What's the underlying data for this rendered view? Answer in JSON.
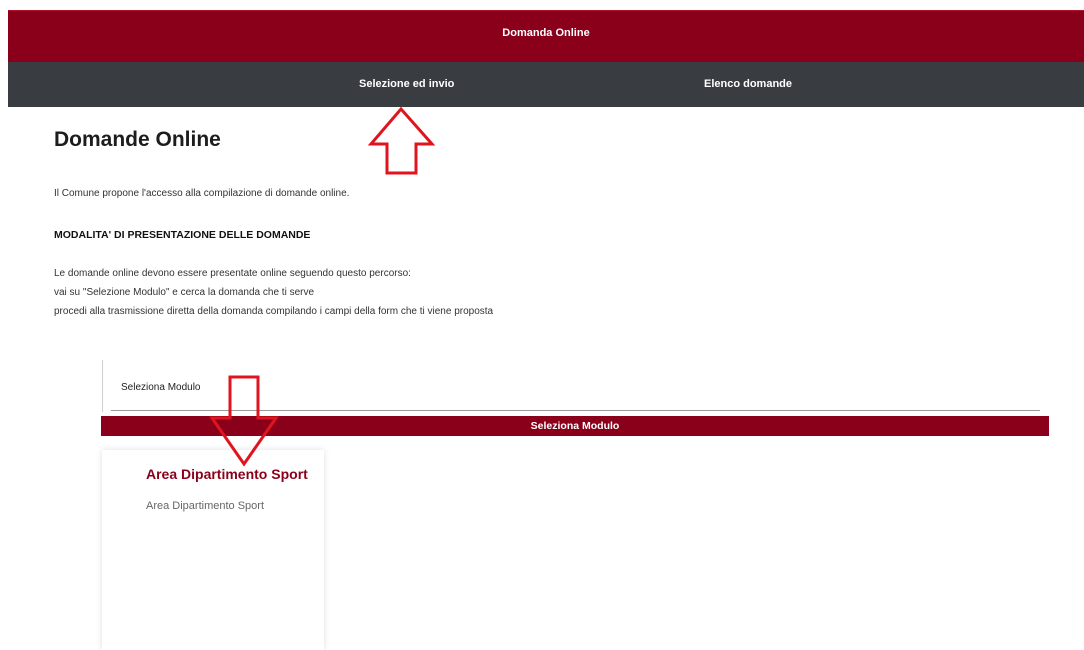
{
  "header": {
    "title": "Domanda Online"
  },
  "subnav": {
    "items": [
      {
        "label": "Selezione ed invio"
      },
      {
        "label": "Elenco domande"
      }
    ]
  },
  "main": {
    "title": "Domande Online",
    "intro": "Il Comune propone l'accesso alla compilazione di domande online.",
    "section_heading": "MODALITA' DI PRESENTAZIONE DELLE DOMANDE",
    "lines": [
      "Le domande online devono essere presentate online seguendo questo percorso:",
      "vai su \"Selezione Modulo\" e cerca la domanda che ti serve",
      "procedi alla trasmissione diretta della domanda compilando i campi della form che ti viene proposta"
    ]
  },
  "module": {
    "tab_label": "Seleziona Modulo",
    "bar_label": "Seleziona Modulo",
    "cards": [
      {
        "title": "Area Dipartimento Sport",
        "description": "Area Dipartimento Sport"
      }
    ]
  },
  "colors": {
    "brand": "#8a001a",
    "subnav": "#393d42",
    "annotation": "#e0141e"
  }
}
